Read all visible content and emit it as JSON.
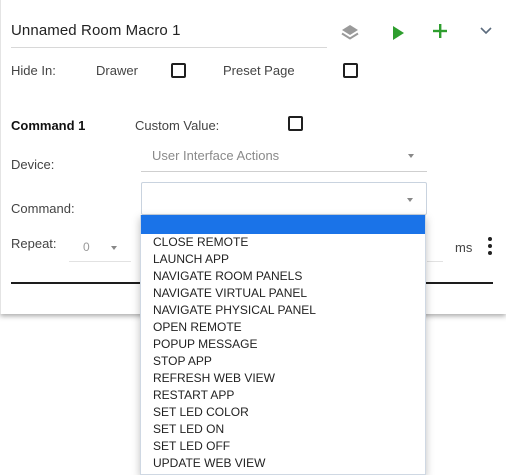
{
  "macro": {
    "name": "Unnamed Room Macro 1"
  },
  "icons": {
    "layers": "layers-icon",
    "run": "play-icon",
    "add": "plus-icon",
    "expand": "chevron-down-icon",
    "more": "more-vert-icon"
  },
  "colors": {
    "run": "#2e9e2e",
    "add": "#2e9e2e",
    "highlight": "#1a73e8"
  },
  "hide_in": {
    "label": "Hide In:",
    "drawer_label": "Drawer",
    "drawer_checked": false,
    "preset_label": "Preset Page",
    "preset_checked": false
  },
  "command_block": {
    "title": "Command 1",
    "custom_value_label": "Custom Value:",
    "custom_value_checked": false,
    "device_label": "Device:",
    "device_value": "User Interface Actions",
    "command_label": "Command:",
    "command_value": "",
    "repeat_label": "Repeat:",
    "repeat_value": "0",
    "delay_unit": "ms"
  },
  "command_options": [
    "CLOSE REMOTE",
    "LAUNCH APP",
    "NAVIGATE ROOM PANELS",
    "NAVIGATE VIRTUAL PANEL",
    "NAVIGATE PHYSICAL PANEL",
    "OPEN REMOTE",
    "POPUP MESSAGE",
    "STOP APP",
    "REFRESH WEB VIEW",
    "RESTART APP",
    "SET LED COLOR",
    "SET LED ON",
    "SET LED OFF",
    "UPDATE WEB VIEW"
  ]
}
